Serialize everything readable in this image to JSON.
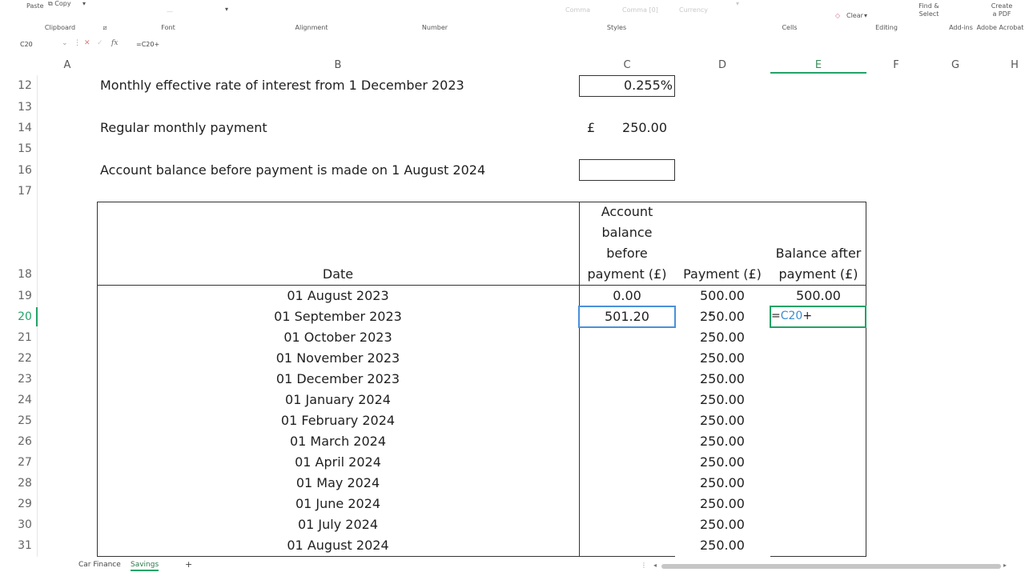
{
  "ribbon": {
    "paste_label": "Paste",
    "copy_label": "Copy",
    "style_comma": "Comma",
    "style_comma0": "Comma [0]",
    "style_currency": "Currency",
    "clear_label": "Clear",
    "find_select_label": "Find & Select",
    "create_pdf_label": "Create a PDF",
    "groups": {
      "clipboard": "Clipboard",
      "font": "Font",
      "alignment": "Alignment",
      "number": "Number",
      "styles": "Styles",
      "cells": "Cells",
      "editing": "Editing",
      "addins": "Add-ins",
      "acrobat": "Adobe Acrobat"
    }
  },
  "formula_bar": {
    "name_box": "C20",
    "fx": "fx",
    "formula": "=C20+"
  },
  "columns": [
    "A",
    "B",
    "C",
    "D",
    "E",
    "F",
    "G",
    "H"
  ],
  "selected_column": "E",
  "rows": [
    "12",
    "13",
    "14",
    "15",
    "16",
    "17",
    "18",
    "19",
    "20",
    "21",
    "22",
    "23",
    "24",
    "25",
    "26",
    "27",
    "28",
    "29",
    "30",
    "31"
  ],
  "selected_row": "20",
  "labels": {
    "monthly_rate": "Monthly effective rate of interest from 1 December 2023",
    "monthly_rate_value": "0.255%",
    "regular_payment": "Regular monthly payment",
    "currency_symbol": "£",
    "regular_payment_value": "250.00",
    "balance_before": "Account balance before payment is made on 1 August 2024",
    "balance_before_value": ""
  },
  "table": {
    "headers": {
      "date": "Date",
      "acct_line1": "Account",
      "acct_line2": "balance",
      "acct_line3": "before",
      "acct_line4": "payment (£)",
      "payment": "Payment (£)",
      "after_line1": "Balance after",
      "after_line2": "payment (£)"
    },
    "rows": [
      {
        "date": "01 August 2023",
        "before": "0.00",
        "payment": "500.00",
        "after": "500.00"
      },
      {
        "date": "01 September 2023",
        "before": "501.20",
        "payment": "250.00",
        "after": ""
      },
      {
        "date": "01 October 2023",
        "before": "",
        "payment": "250.00",
        "after": ""
      },
      {
        "date": "01 November 2023",
        "before": "",
        "payment": "250.00",
        "after": ""
      },
      {
        "date": "01 December 2023",
        "before": "",
        "payment": "250.00",
        "after": ""
      },
      {
        "date": "01 January 2024",
        "before": "",
        "payment": "250.00",
        "after": ""
      },
      {
        "date": "01 February 2024",
        "before": "",
        "payment": "250.00",
        "after": ""
      },
      {
        "date": "01 March 2024",
        "before": "",
        "payment": "250.00",
        "after": ""
      },
      {
        "date": "01 April 2024",
        "before": "",
        "payment": "250.00",
        "after": ""
      },
      {
        "date": "01 May 2024",
        "before": "",
        "payment": "250.00",
        "after": ""
      },
      {
        "date": "01 June 2024",
        "before": "",
        "payment": "250.00",
        "after": ""
      },
      {
        "date": "01 July 2024",
        "before": "",
        "payment": "250.00",
        "after": ""
      },
      {
        "date": "01 August 2024",
        "before": "",
        "payment": "250.00",
        "after": ""
      }
    ],
    "edit_formula_prefix": "=",
    "edit_formula_ref": "C20",
    "edit_formula_suffix": "+"
  },
  "sheets": {
    "car_finance": "Car Finance",
    "savings": "Savings",
    "add": "+"
  },
  "colors": {
    "accent_green": "#21a366",
    "active_blue": "#4a90d9",
    "ref_blue": "#3b8ed0"
  }
}
